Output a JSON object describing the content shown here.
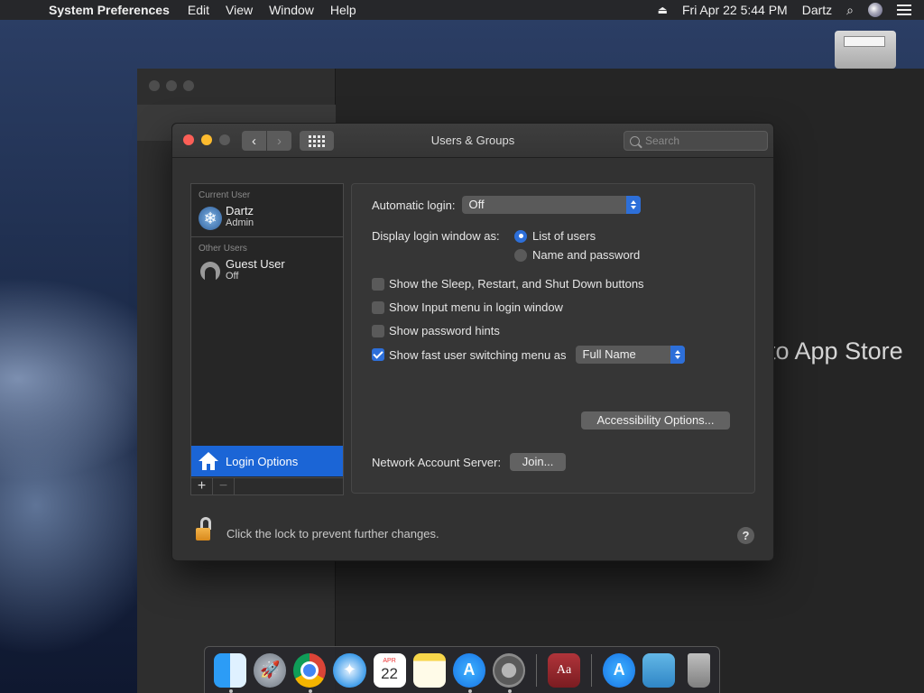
{
  "menubar": {
    "apple_glyph": "",
    "app_name": "System Preferences",
    "menus": [
      "Edit",
      "View",
      "Window",
      "Help"
    ],
    "datetime": "Fri Apr 22  5:44 PM",
    "user": "Dartz"
  },
  "background_window": {
    "partial_text": "to App Store"
  },
  "window": {
    "title": "Users & Groups",
    "search_placeholder": "Search"
  },
  "users": {
    "current_label": "Current User",
    "current": {
      "name": "Dartz",
      "role": "Admin"
    },
    "other_label": "Other Users",
    "others": [
      {
        "name": "Guest User",
        "role": "Off"
      }
    ],
    "login_options_label": "Login Options",
    "add_label": "+",
    "remove_label": "−"
  },
  "login": {
    "automatic_login_label": "Automatic login:",
    "automatic_login_value": "Off",
    "display_as_label": "Display login window as:",
    "display_options": [
      "List of users",
      "Name and password"
    ],
    "display_selected": 0,
    "checkboxes": [
      {
        "label": "Show the Sleep, Restart, and Shut Down buttons",
        "checked": false
      },
      {
        "label": "Show Input menu in login window",
        "checked": false
      },
      {
        "label": "Show password hints",
        "checked": false
      },
      {
        "label": "Show fast user switching menu as",
        "checked": true
      }
    ],
    "fast_switch_value": "Full Name",
    "accessibility_button": "Accessibility Options...",
    "network_label": "Network Account Server:",
    "join_button": "Join..."
  },
  "footer": {
    "lock_text": "Click the lock to prevent further changes.",
    "help_glyph": "?"
  },
  "dock": {
    "calendar_month": "APR",
    "calendar_day": "22",
    "dictionary_glyph": "Aa"
  },
  "colors": {
    "accent": "#2d6fd9",
    "selection": "#1b65d6",
    "close": "#fc5f57",
    "minimize": "#fdbb2e"
  }
}
